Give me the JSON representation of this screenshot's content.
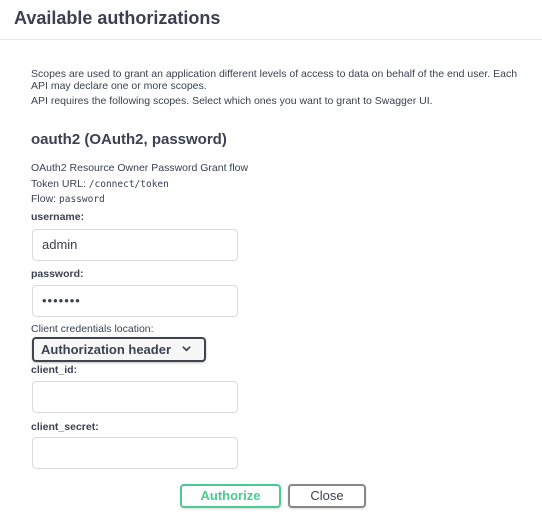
{
  "modal": {
    "title": "Available authorizations"
  },
  "scopes": {
    "description": "Scopes are used to grant an application different levels of access to data on behalf of the end user. Each API may declare one or more scopes.",
    "requirement": "API requires the following scopes. Select which ones you want to grant to Swagger UI."
  },
  "scheme": {
    "title": "oauth2 (OAuth2, password)",
    "flow_description": "OAuth2 Resource Owner Password Grant flow",
    "token_url_label": "Token URL:",
    "token_url": "/connect/token",
    "flow_label": "Flow:",
    "flow": "password"
  },
  "form": {
    "username_label": "username:",
    "username_value": "admin",
    "password_label": "password:",
    "password_masked": "•••••••",
    "client_location_label": "Client credentials location:",
    "client_location_value": "Authorization header",
    "client_id_label": "client_id:",
    "client_id_value": "",
    "client_secret_label": "client_secret:",
    "client_secret_value": ""
  },
  "buttons": {
    "authorize": "Authorize",
    "close": "Close"
  },
  "colors": {
    "authorize_accent": "#49cc90",
    "text": "#3b4151"
  },
  "icons": {
    "select_arrow": "chevron-down-icon"
  }
}
